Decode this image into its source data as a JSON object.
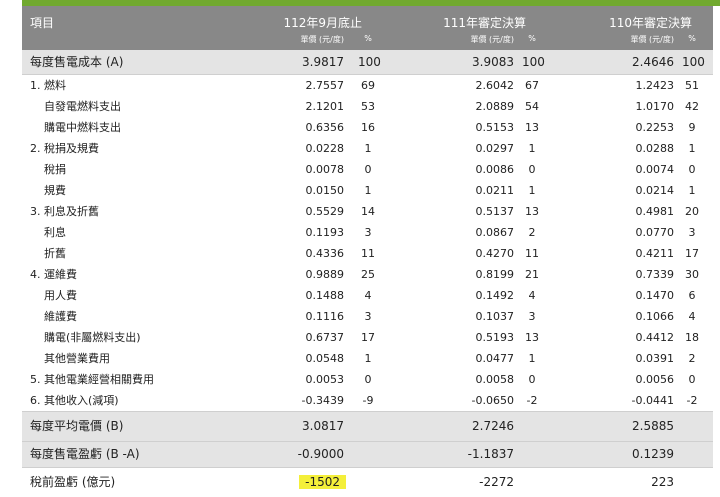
{
  "header": {
    "item": "項目",
    "col1": "112年9月底止",
    "col2": "111年審定決算",
    "col3": "110年審定決算",
    "unit": "單價 (元/度)",
    "pct": "%"
  },
  "rows": [
    {
      "label": "每度售電成本 (A)",
      "v1": "3.9817",
      "p1": "100",
      "v2": "3.9083",
      "p2": "100",
      "v3": "2.4646",
      "p3": "100"
    },
    {
      "label": "1. 燃料",
      "v1": "2.7557",
      "p1": "69",
      "v2": "2.6042",
      "p2": "67",
      "v3": "1.2423",
      "p3": "51"
    },
    {
      "label": "自發電燃料支出",
      "v1": "2.1201",
      "p1": "53",
      "v2": "2.0889",
      "p2": "54",
      "v3": "1.0170",
      "p3": "42"
    },
    {
      "label": "購電中燃料支出",
      "v1": "0.6356",
      "p1": "16",
      "v2": "0.5153",
      "p2": "13",
      "v3": "0.2253",
      "p3": "9"
    },
    {
      "label": "2. 稅捐及規費",
      "v1": "0.0228",
      "p1": "1",
      "v2": "0.0297",
      "p2": "1",
      "v3": "0.0288",
      "p3": "1"
    },
    {
      "label": "稅捐",
      "v1": "0.0078",
      "p1": "0",
      "v2": "0.0086",
      "p2": "0",
      "v3": "0.0074",
      "p3": "0"
    },
    {
      "label": "規費",
      "v1": "0.0150",
      "p1": "1",
      "v2": "0.0211",
      "p2": "1",
      "v3": "0.0214",
      "p3": "1"
    },
    {
      "label": "3. 利息及折舊",
      "v1": "0.5529",
      "p1": "14",
      "v2": "0.5137",
      "p2": "13",
      "v3": "0.4981",
      "p3": "20"
    },
    {
      "label": "利息",
      "v1": "0.1193",
      "p1": "3",
      "v2": "0.0867",
      "p2": "2",
      "v3": "0.0770",
      "p3": "3"
    },
    {
      "label": "折舊",
      "v1": "0.4336",
      "p1": "11",
      "v2": "0.4270",
      "p2": "11",
      "v3": "0.4211",
      "p3": "17"
    },
    {
      "label": "4. 運維費",
      "v1": "0.9889",
      "p1": "25",
      "v2": "0.8199",
      "p2": "21",
      "v3": "0.7339",
      "p3": "30"
    },
    {
      "label": "用人費",
      "v1": "0.1488",
      "p1": "4",
      "v2": "0.1492",
      "p2": "4",
      "v3": "0.1470",
      "p3": "6"
    },
    {
      "label": "維護費",
      "v1": "0.1116",
      "p1": "3",
      "v2": "0.1037",
      "p2": "3",
      "v3": "0.1066",
      "p3": "4"
    },
    {
      "label": "購電(非屬燃料支出)",
      "v1": "0.6737",
      "p1": "17",
      "v2": "0.5193",
      "p2": "13",
      "v3": "0.4412",
      "p3": "18"
    },
    {
      "label": "其他營業費用",
      "v1": "0.0548",
      "p1": "1",
      "v2": "0.0477",
      "p2": "1",
      "v3": "0.0391",
      "p3": "2"
    },
    {
      "label": "5. 其他電業經營相關費用",
      "v1": "0.0053",
      "p1": "0",
      "v2": "0.0058",
      "p2": "0",
      "v3": "0.0056",
      "p3": "0"
    },
    {
      "label": "6. 其他收入(減項)",
      "v1": "-0.3439",
      "p1": "-9",
      "v2": "-0.0650",
      "p2": "-2",
      "v3": "-0.0441",
      "p3": "-2"
    },
    {
      "label": "每度平均電價 (B)",
      "v1": "3.0817",
      "p1": "",
      "v2": "2.7246",
      "p2": "",
      "v3": "2.5885",
      "p3": ""
    },
    {
      "label": "每度售電盈虧 (B -A)",
      "v1": "-0.9000",
      "p1": "",
      "v2": "-1.1837",
      "p2": "",
      "v3": "0.1239",
      "p3": ""
    },
    {
      "label": "稅前盈虧 (億元)",
      "v1": "-1502",
      "p1": "",
      "v2": "-2272",
      "p2": "",
      "v3": "223",
      "p3": ""
    }
  ]
}
